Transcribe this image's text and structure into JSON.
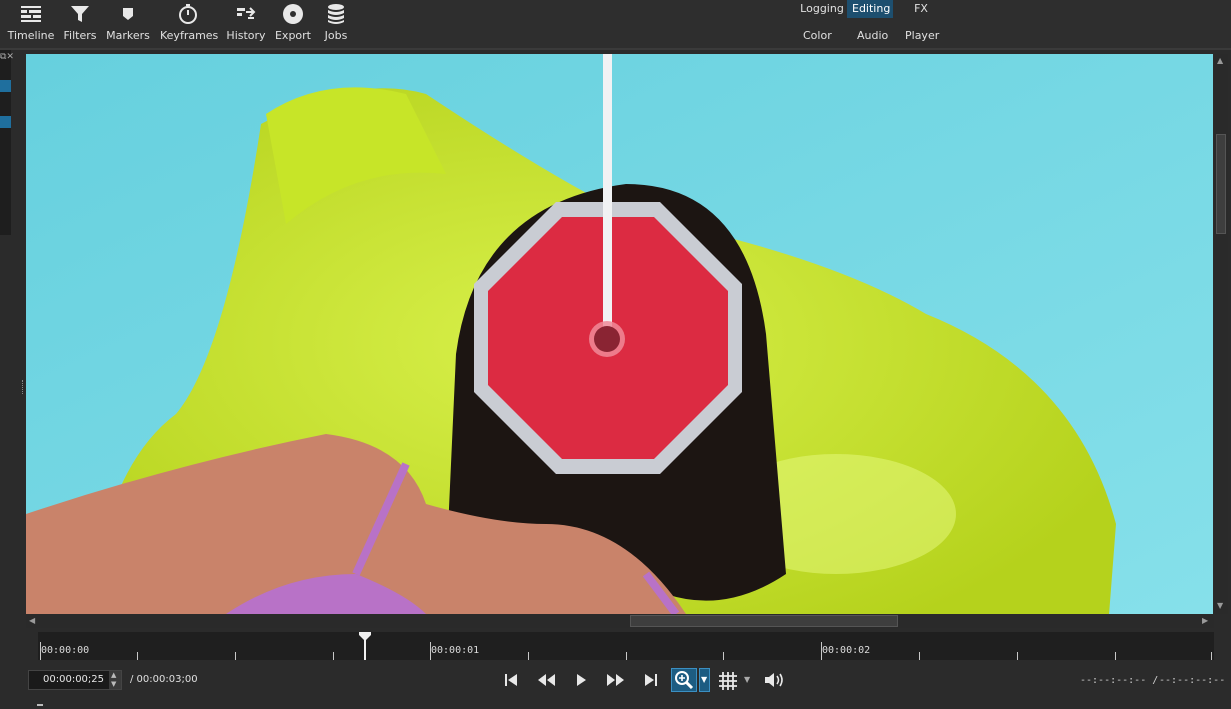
{
  "toolbar": {
    "items": [
      {
        "label": "Timeline",
        "icon": "timeline-icon"
      },
      {
        "label": "Filters",
        "icon": "filter-icon"
      },
      {
        "label": "Markers",
        "icon": "marker-icon"
      },
      {
        "label": "Keyframes",
        "icon": "stopwatch-icon"
      },
      {
        "label": "History",
        "icon": "history-icon"
      },
      {
        "label": "Export",
        "icon": "disc-icon"
      },
      {
        "label": "Jobs",
        "icon": "database-icon"
      }
    ]
  },
  "layouts": {
    "row1": [
      "Logging",
      "Editing",
      "FX"
    ],
    "row2": [
      "Color",
      "Audio",
      "Player"
    ],
    "active": "Editing"
  },
  "ruler": {
    "labels": [
      "00:00:00",
      "00:00:01",
      "00:00:02"
    ]
  },
  "transport": {
    "current_timecode": "00:00:00;25",
    "total_duration": "/ 00:00:03;00",
    "in_point": "--:--:--:-- /",
    "out_point": "--:--:--:--"
  },
  "colors": {
    "accent": "#1d4f6f",
    "stop_sign_red": "#dc2b42",
    "stop_sign_border": "#c9ccd3",
    "water": "#6fd6e3",
    "float_yellow": "#c8e62e"
  }
}
